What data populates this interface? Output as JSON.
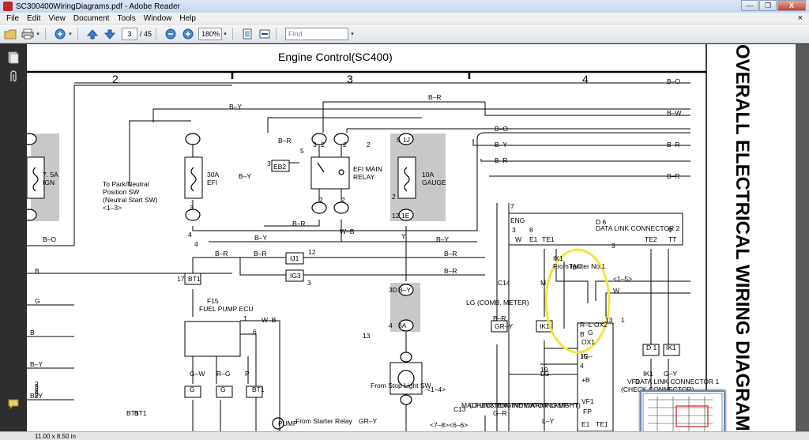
{
  "window": {
    "title": "SC300400WiringDiagrams.pdf - Adobe Reader",
    "controls": [
      "—",
      "❐",
      "X"
    ]
  },
  "menu": {
    "items": [
      "File",
      "Edit",
      "View",
      "Document",
      "Tools",
      "Window",
      "Help"
    ],
    "close_doc": "×"
  },
  "toolbar": {
    "current_page": "3",
    "page_count": "/ 45",
    "zoom": "180%",
    "find_placeholder": "Find"
  },
  "status": {
    "page_size": "11.00 x 8.50 in"
  },
  "diagram": {
    "heading": "Engine Control(SC400)",
    "sidebar_title": "OVERALL ELECTRICAL WIRING DIAGRAM",
    "columns": [
      "2",
      "3",
      "4"
    ],
    "texts": [
      "B–O",
      "B–R",
      "B–W",
      "B–Y",
      "B–O",
      "B–Y",
      "B–R",
      "B–R",
      "B–R",
      "1J",
      "7. 5A",
      "IGN",
      "1I",
      "B–O",
      "To Park/Neutral",
      "Position SW",
      "(Neutral Start SW)",
      "<1–3>",
      "30A",
      "EFI",
      "B–Y",
      "B–Y",
      "EB2",
      "B–R",
      "3",
      "EFI MAIN",
      "RELAY",
      "W–B",
      "B–R",
      "5",
      "1J",
      "10A",
      "GAUGE",
      "12",
      "1E",
      "Y",
      "B–Y",
      "7",
      "ENG",
      "D 6",
      "DATA LINK CONNECTOR 2",
      "W",
      "E1",
      "TE1",
      "TE2",
      "TT",
      "B–R",
      "B–R",
      "IJ1",
      "IG3",
      "12",
      "3",
      "B",
      "BT1",
      "17",
      "B–R",
      "B–R",
      "F15",
      "FUEL PUMP ECU",
      "W–B",
      "1",
      "6",
      "G",
      "B",
      "B–Y",
      "B–Y",
      "B–Y",
      "3A",
      "3D",
      "4",
      "13",
      "From Stop Light SW",
      "<7–8><6–6>",
      "C13",
      "MALFUNCTION INDICATOR LAMP",
      "(CHECK ENGINE WARNING LIGHT)",
      "(COMB. METER)",
      "B–R",
      "GR–Y",
      "IK1",
      "IK1",
      "From Igniter No.1",
      "TAC",
      "<1–5>",
      "W",
      "R–L",
      "OX2",
      "OX1",
      "IG–",
      "+B",
      "VF1",
      "FP",
      "E1",
      "TE1",
      "VF2",
      "DATA LINK CONNECTOR 1",
      "(CHECK CONNECTOR)",
      "D 1",
      "IK1",
      "IK1",
      "G–Y",
      "G–R",
      "GR–Y",
      "G–W",
      "R–G",
      "P",
      "G",
      "G",
      "BT1",
      "BT1",
      "BT1",
      "From Starter Relay",
      "<1–4>",
      "PUMP",
      "C14",
      "M",
      "L–Y",
      "LG",
      "LG",
      "B",
      "G",
      "15",
      "4",
      "19",
      "13",
      "1",
      "3",
      "4",
      "3",
      "8",
      "9",
      "5",
      "3",
      "2",
      "2",
      "2",
      "2",
      "2",
      "2",
      "4",
      "3",
      "2",
      "3",
      "2",
      "2",
      "8",
      "2"
    ]
  },
  "colors": {
    "accent": "#1d4f9a",
    "annotation": "#f2e63b",
    "shaded_box": "#c8c8c8"
  }
}
